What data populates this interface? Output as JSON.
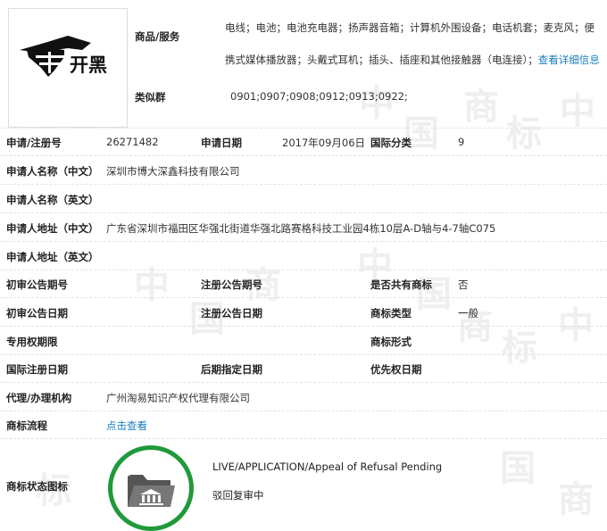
{
  "logo": {
    "text": "开黑"
  },
  "goods": {
    "label": "商品/服务",
    "value": "电线；电池；电池充电器；扬声器音箱；计算机外围设备；电话机套；麦克风；便携式媒体播放器；头戴式耳机；插头、插座和其他接触器（电连接）；",
    "link": "查看详细信息"
  },
  "similar_group": {
    "label": "类似群",
    "value": "0901;0907;0908;0912;0913;0922;"
  },
  "rows": {
    "reg_no": {
      "label": "申请/注册号",
      "value": "26271482"
    },
    "app_date": {
      "label": "申请日期",
      "value": "2017年09月06日"
    },
    "intl_class": {
      "label": "国际分类",
      "value": "9"
    },
    "applicant_cn": {
      "label": "申请人名称（中文）",
      "value": "深圳市博大深鑫科技有限公司"
    },
    "applicant_en": {
      "label": "申请人名称（英文）",
      "value": ""
    },
    "address_cn": {
      "label": "申请人地址（中文）",
      "value": "广东省深圳市福田区华强北街道华强北路赛格科技工业园4栋10层A-D轴与4-7轴C075"
    },
    "address_en": {
      "label": "申请人地址（英文）",
      "value": ""
    },
    "prelim_pub_no": {
      "label": "初审公告期号",
      "value": ""
    },
    "reg_pub_no": {
      "label": "注册公告期号",
      "value": ""
    },
    "shared": {
      "label": "是否共有商标",
      "value": "否"
    },
    "prelim_pub_date": {
      "label": "初审公告日期",
      "value": ""
    },
    "reg_pub_date": {
      "label": "注册公告日期",
      "value": ""
    },
    "tm_type": {
      "label": "商标类型",
      "value": "一般"
    },
    "exclusive_period": {
      "label": "专用权期限",
      "value": ""
    },
    "tm_form": {
      "label": "商标形式",
      "value": ""
    },
    "intl_reg_date": {
      "label": "国际注册日期",
      "value": ""
    },
    "later_date": {
      "label": "后期指定日期",
      "value": ""
    },
    "priority_date": {
      "label": "优先权日期",
      "value": ""
    },
    "agent": {
      "label": "代理/办理机构",
      "value": "广州淘易知识产权代理有限公司"
    },
    "process": {
      "label": "商标流程",
      "link": "点击查看"
    }
  },
  "status": {
    "label": "商标状态图标",
    "en": "LIVE/APPLICATION/Appeal of Refusal Pending",
    "cn": "驳回复审中"
  },
  "watermark": [
    "中",
    "国",
    "商",
    "标"
  ],
  "colors": {
    "link": "#1a7fc1",
    "status_green": "#1f9a3b"
  }
}
